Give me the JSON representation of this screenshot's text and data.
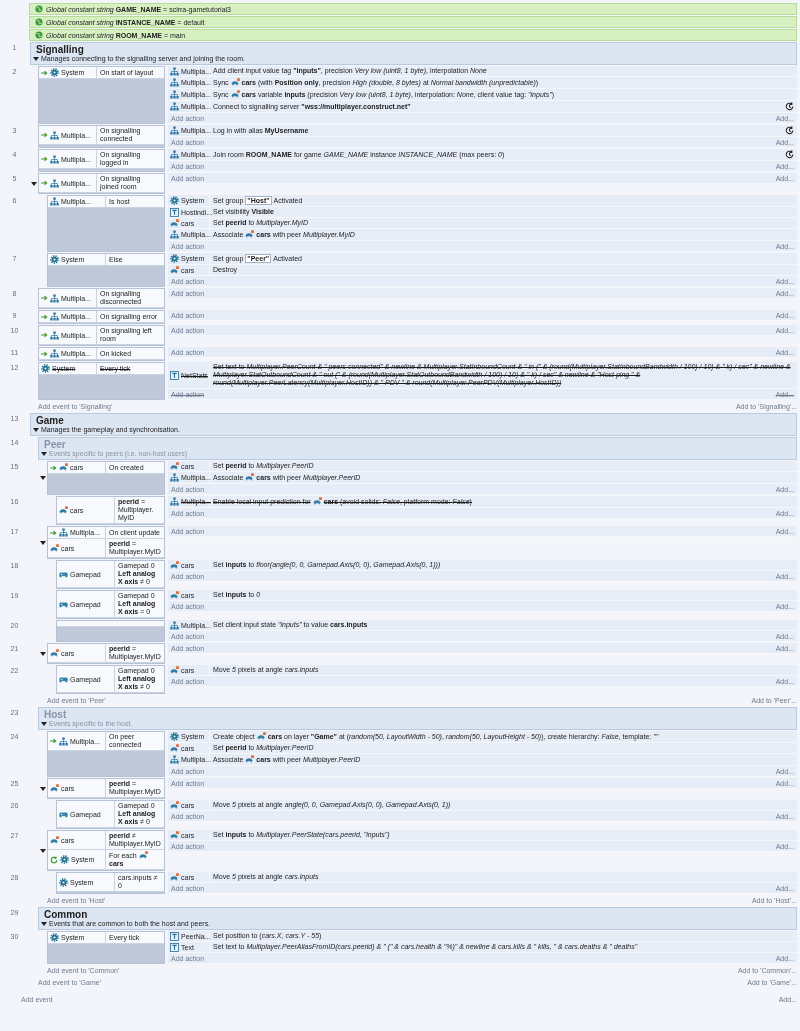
{
  "globals": [
    {
      "text": "*Global constant string* **GAME_NAME** = scirra-gametutorial3"
    },
    {
      "text": "*Global constant string* **INSTANCE_NAME** = default"
    },
    {
      "text": "*Global constant string* **ROOM_NAME** = main"
    }
  ],
  "sheet": [
    {
      "kind": "group",
      "number": "1",
      "title": "Signalling",
      "description": "Manages connecting to the signalling server and joining the room.",
      "active": true,
      "expanded": true,
      "add_event": "Add event to 'Signalling'",
      "add_to": "Add to 'Signalling'...",
      "children": [
        {
          "kind": "event",
          "number": "2",
          "disabled": false,
          "conditions": [
            {
              "object": {
                "name": "System",
                "kind": "system"
              },
              "kind": "trigger",
              "text": "On start of layout"
            }
          ],
          "actions": [
            {
              "object": {
                "name": "Multipla...",
                "kind": "multiplayer"
              },
              "disabled": false,
              "async": false,
              "text": "Add client input value tag **\"inputs\"**, precision *Very low (uint8, 1 byte)*, interpolation *None*"
            },
            {
              "object": {
                "name": "Multipla...",
                "kind": "multiplayer"
              },
              "disabled": false,
              "async": false,
              "parts": [
                {
                  "kind": "text",
                  "text": "Sync"
                },
                {
                  "kind": "sprite"
                },
                {
                  "kind": "text",
                  "text": "**cars** (with **Position only**, precision *High (double, 8 bytes)* at *Normal bandwidth (unpredictable)*)"
                }
              ]
            },
            {
              "object": {
                "name": "Multipla...",
                "kind": "multiplayer"
              },
              "disabled": false,
              "async": false,
              "parts": [
                {
                  "kind": "text",
                  "text": "Sync"
                },
                {
                  "kind": "sprite"
                },
                {
                  "kind": "text",
                  "text": "**cars** variable **inputs** (precision *Very low (uint8, 1 byte)*, interpolation: *None*, client value tag: *\"inputs\"*)"
                }
              ]
            },
            {
              "object": {
                "name": "Multipla...",
                "kind": "multiplayer"
              },
              "disabled": false,
              "async": true,
              "text": "Connect to signalling server **\"wss://multiplayer.construct.net\"**"
            }
          ],
          "add_action": "Add action",
          "add_more": "Add..."
        },
        {
          "kind": "event",
          "number": "3",
          "disabled": false,
          "conditions": [
            {
              "object": {
                "name": "Multipla...",
                "kind": "multiplayer"
              },
              "kind": "trigger",
              "text": "On signalling connected"
            }
          ],
          "actions": [
            {
              "object": {
                "name": "Multipla...",
                "kind": "multiplayer"
              },
              "disabled": false,
              "async": true,
              "text": "Log in with alias **MyUsername**"
            }
          ],
          "add_action": "Add action",
          "add_more": "Add..."
        },
        {
          "kind": "event",
          "number": "4",
          "disabled": false,
          "conditions": [
            {
              "object": {
                "name": "Multipla...",
                "kind": "multiplayer"
              },
              "kind": "trigger",
              "text": "On signalling logged in"
            }
          ],
          "actions": [
            {
              "object": {
                "name": "Multipla...",
                "kind": "multiplayer"
              },
              "disabled": false,
              "async": true,
              "text": "Join room **ROOM_NAME** for game *GAME_NAME* instance *INSTANCE_NAME* (max peers: *0*)"
            }
          ],
          "add_action": "Add action",
          "add_more": "Add..."
        },
        {
          "kind": "event",
          "number": "5",
          "disabled": false,
          "expanded": true,
          "conditions": [
            {
              "object": {
                "name": "Multipla...",
                "kind": "multiplayer"
              },
              "kind": "trigger",
              "text": "On signalling joined room"
            }
          ],
          "add_action": "Add action",
          "add_more": "Add...",
          "children": [
            {
              "kind": "event",
              "number": "6",
              "disabled": false,
              "conditions": [
                {
                  "object": {
                    "name": "Multipla...",
                    "kind": "multiplayer"
                  },
                  "text": "Is host"
                }
              ],
              "actions": [
                {
                  "object": {
                    "name": "System",
                    "kind": "system"
                  },
                  "disabled": false,
                  "async": false,
                  "parts": [
                    {
                      "kind": "text",
                      "text": "Set group"
                    },
                    {
                      "kind": "chip",
                      "text": "\"Host\""
                    },
                    {
                      "kind": "text",
                      "text": "Activated"
                    }
                  ]
                },
                {
                  "object": {
                    "name": "Hostindi...",
                    "kind": "text"
                  },
                  "disabled": false,
                  "async": false,
                  "text": "Set visibility **Visible**"
                },
                {
                  "object": {
                    "name": "cars",
                    "kind": "sprite"
                  },
                  "disabled": false,
                  "async": false,
                  "text": "Set **peerid** to *Multiplayer.MyID*"
                },
                {
                  "object": {
                    "name": "Multipla...",
                    "kind": "multiplayer"
                  },
                  "disabled": false,
                  "async": false,
                  "parts": [
                    {
                      "kind": "text",
                      "text": "Associate"
                    },
                    {
                      "kind": "sprite"
                    },
                    {
                      "kind": "text",
                      "text": "**cars** with peer *Multiplayer.MyID*"
                    }
                  ]
                }
              ],
              "add_action": "Add action",
              "add_more": "Add..."
            },
            {
              "kind": "event",
              "number": "7",
              "disabled": false,
              "conditions": [
                {
                  "object": {
                    "name": "System",
                    "kind": "system"
                  },
                  "text": "Else"
                }
              ],
              "actions": [
                {
                  "object": {
                    "name": "System",
                    "kind": "system"
                  },
                  "disabled": false,
                  "async": false,
                  "parts": [
                    {
                      "kind": "text",
                      "text": "Set group"
                    },
                    {
                      "kind": "chip",
                      "text": "\"Peer\""
                    },
                    {
                      "kind": "text",
                      "text": "Activated"
                    }
                  ]
                },
                {
                  "object": {
                    "name": "cars",
                    "kind": "sprite"
                  },
                  "disabled": false,
                  "async": false,
                  "text": "Destroy"
                }
              ],
              "add_action": "Add action",
              "add_more": "Add..."
            }
          ]
        },
        {
          "kind": "event",
          "number": "8",
          "disabled": false,
          "conditions": [
            {
              "object": {
                "name": "Multipla...",
                "kind": "multiplayer"
              },
              "kind": "trigger",
              "text": "On signalling disconnected"
            }
          ],
          "add_action": "Add action",
          "add_more": "Add..."
        },
        {
          "kind": "event",
          "number": "9",
          "disabled": false,
          "conditions": [
            {
              "object": {
                "name": "Multipla...",
                "kind": "multiplayer"
              },
              "kind": "trigger",
              "text": "On signalling error"
            }
          ],
          "add_action": "Add action",
          "add_more": "Add..."
        },
        {
          "kind": "event",
          "number": "10",
          "disabled": false,
          "conditions": [
            {
              "object": {
                "name": "Multipla...",
                "kind": "multiplayer"
              },
              "kind": "trigger",
              "text": "On signalling left room"
            }
          ],
          "add_action": "Add action",
          "add_more": "Add..."
        },
        {
          "kind": "event",
          "number": "11",
          "disabled": false,
          "conditions": [
            {
              "object": {
                "name": "Multipla...",
                "kind": "multiplayer"
              },
              "kind": "trigger",
              "text": "On kicked"
            }
          ],
          "add_action": "Add action",
          "add_more": "Add..."
        },
        {
          "kind": "event",
          "number": "12",
          "disabled": true,
          "conditions": [
            {
              "object": {
                "name": "System",
                "kind": "system"
              },
              "text": "Every tick"
            }
          ],
          "actions": [
            {
              "object": {
                "name": "NetStats",
                "kind": "text"
              },
              "disabled": false,
              "async": false,
              "text": "Set text to *Multiplayer.PeerCount & \" peers connected\" & newline & Multiplayer.StatInboundCount & \" in (\" & (round(Multiplayer.StatInboundBandwidth / 100) / 10) & \" k) / sec\" & newline & Multiplayer.StatOutboundCount & \" out (\" & (round(Multiplayer.StatOutboundBandwidth / 100) / 10) & \" k) / sec\" & newline & \"Host ping \" & round(Multiplayer.PeerLatency(Multiplayer.HostID)) & \" PDV \" & round(Multiplayer.PeerPDV(Multiplayer.HostID))*"
            }
          ],
          "add_action": "Add action",
          "add_more": "Add..."
        }
      ]
    },
    {
      "kind": "group",
      "number": "13",
      "title": "Game",
      "description": "Manages the gameplay and synchronisation.",
      "active": true,
      "expanded": true,
      "add_event": "Add event to 'Game'",
      "add_to": "Add to 'Game'...",
      "children": [
        {
          "kind": "group",
          "number": "14",
          "title": "Peer",
          "description": "Events specific to peers (i.e. non-host users)",
          "active": false,
          "expanded": true,
          "add_event": "Add event to 'Peer'",
          "add_to": "Add to 'Peer'...",
          "children": [
            {
              "kind": "event",
              "number": "15",
              "disabled": false,
              "expanded": true,
              "conditions": [
                {
                  "object": {
                    "name": "cars",
                    "kind": "sprite"
                  },
                  "kind": "trigger",
                  "text": "On created"
                }
              ],
              "actions": [
                {
                  "object": {
                    "name": "cars",
                    "kind": "sprite"
                  },
                  "disabled": false,
                  "async": false,
                  "text": "Set **peerid** to *Multiplayer.PeerID*"
                },
                {
                  "object": {
                    "name": "Multipla...",
                    "kind": "multiplayer"
                  },
                  "disabled": false,
                  "async": false,
                  "parts": [
                    {
                      "kind": "text",
                      "text": "Associate"
                    },
                    {
                      "kind": "sprite"
                    },
                    {
                      "kind": "text",
                      "text": "**cars** with peer *Multiplayer.PeerID*"
                    }
                  ]
                }
              ],
              "add_action": "Add action",
              "add_more": "Add...",
              "children": [
                {
                  "kind": "event",
                  "number": "16",
                  "disabled": false,
                  "conditions": [
                    {
                      "object": {
                        "name": "cars",
                        "kind": "sprite"
                      },
                      "text": "**peerid** = Multiplayer. MyID"
                    }
                  ],
                  "actions": [
                    {
                      "object": {
                        "name": "Multipla...",
                        "kind": "multiplayer"
                      },
                      "disabled": true,
                      "async": false,
                      "parts": [
                        {
                          "kind": "text",
                          "text": "Enable local input prediction for"
                        },
                        {
                          "kind": "sprite"
                        },
                        {
                          "kind": "text",
                          "text": "**cars** (avoid solids: *False*, platform mode: *False*)"
                        }
                      ]
                    }
                  ],
                  "add_action": "Add action",
                  "add_more": "Add..."
                }
              ]
            },
            {
              "kind": "event",
              "number": "17",
              "disabled": false,
              "expanded": true,
              "conditions": [
                {
                  "object": {
                    "name": "Multipla...",
                    "kind": "multiplayer"
                  },
                  "kind": "trigger",
                  "text": "On client update"
                },
                {
                  "object": {
                    "name": "cars",
                    "kind": "sprite"
                  },
                  "text": "**peerid** = Multiplayer.MyID"
                }
              ],
              "add_action": "Add action",
              "add_more": "Add...",
              "children": [
                {
                  "kind": "event",
                  "number": "18",
                  "disabled": false,
                  "conditions": [
                    {
                      "object": {
                        "name": "Gamepad",
                        "kind": "gamepad"
                      },
                      "text": "Gamepad 0 **Left analog X axis** ≠ 0"
                    }
                  ],
                  "actions": [
                    {
                      "object": {
                        "name": "cars",
                        "kind": "sprite"
                      },
                      "disabled": false,
                      "async": false,
                      "text": "Set **inputs** to *floor(angle(0, 0, Gamepad.Axis(0, 0), Gamepad.Axis(0, 1)))*"
                    }
                  ],
                  "add_action": "Add action",
                  "add_more": "Add..."
                },
                {
                  "kind": "event",
                  "number": "19",
                  "disabled": false,
                  "conditions": [
                    {
                      "object": {
                        "name": "Gamepad",
                        "kind": "gamepad"
                      },
                      "text": "Gamepad 0 **Left analog X axis** = 0"
                    }
                  ],
                  "actions": [
                    {
                      "object": {
                        "name": "cars",
                        "kind": "sprite"
                      },
                      "disabled": false,
                      "async": false,
                      "text": "Set **inputs** to *0*"
                    }
                  ],
                  "add_action": "Add action",
                  "add_more": "Add..."
                },
                {
                  "kind": "event",
                  "number": "20",
                  "disabled": false,
                  "actions": [
                    {
                      "object": {
                        "name": "Multipla...",
                        "kind": "multiplayer"
                      },
                      "disabled": false,
                      "async": false,
                      "text": "Set client input state *\"inputs\"* to value **cars.inputs**"
                    }
                  ],
                  "add_action": "Add action",
                  "add_more": "Add..."
                }
              ]
            },
            {
              "kind": "event",
              "number": "21",
              "disabled": false,
              "expanded": true,
              "conditions": [
                {
                  "object": {
                    "name": "cars",
                    "kind": "sprite"
                  },
                  "text": "**peerid** = Multiplayer.MyID"
                }
              ],
              "add_action": "Add action",
              "add_more": "Add...",
              "children": [
                {
                  "kind": "event",
                  "number": "22",
                  "disabled": false,
                  "conditions": [
                    {
                      "object": {
                        "name": "Gamepad",
                        "kind": "gamepad"
                      },
                      "text": "Gamepad 0 **Left analog X axis** ≠ 0"
                    }
                  ],
                  "actions": [
                    {
                      "object": {
                        "name": "cars",
                        "kind": "sprite"
                      },
                      "disabled": false,
                      "async": false,
                      "text": "Move *5* pixels at angle *cars.inputs*"
                    }
                  ],
                  "add_action": "Add action",
                  "add_more": "Add..."
                }
              ]
            }
          ]
        },
        {
          "kind": "group",
          "number": "23",
          "title": "Host",
          "description": "Events specific to the host.",
          "active": false,
          "expanded": true,
          "add_event": "Add event to 'Host'",
          "add_to": "Add to 'Host'...",
          "children": [
            {
              "kind": "event",
              "number": "24",
              "disabled": false,
              "conditions": [
                {
                  "object": {
                    "name": "Multipla...",
                    "kind": "multiplayer"
                  },
                  "kind": "trigger",
                  "text": "On peer connected"
                }
              ],
              "actions": [
                {
                  "object": {
                    "name": "System",
                    "kind": "system"
                  },
                  "disabled": false,
                  "async": false,
                  "parts": [
                    {
                      "kind": "text",
                      "text": "Create object"
                    },
                    {
                      "kind": "sprite"
                    },
                    {
                      "kind": "text",
                      "text": "**cars** on layer **\"Game\"** at (*random(50, LayoutWidth - 50)*, *random(50, LayoutHeight - 50)*), create hierarchy: *False*, template: *\"\"*"
                    }
                  ]
                },
                {
                  "object": {
                    "name": "cars",
                    "kind": "sprite"
                  },
                  "disabled": false,
                  "async": false,
                  "text": "Set **peerid** to *Multiplayer.PeerID*"
                },
                {
                  "object": {
                    "name": "Multipla...",
                    "kind": "multiplayer"
                  },
                  "disabled": false,
                  "async": false,
                  "parts": [
                    {
                      "kind": "text",
                      "text": "Associate"
                    },
                    {
                      "kind": "sprite"
                    },
                    {
                      "kind": "text",
                      "text": "**cars** with peer *Multiplayer.PeerID*"
                    }
                  ]
                }
              ],
              "add_action": "Add action",
              "add_more": "Add..."
            },
            {
              "kind": "event",
              "number": "25",
              "disabled": false,
              "expanded": true,
              "conditions": [
                {
                  "object": {
                    "name": "cars",
                    "kind": "sprite"
                  },
                  "text": "**peerid** = Multiplayer.MyID"
                }
              ],
              "add_action": "Add action",
              "add_more": "Add...",
              "children": [
                {
                  "kind": "event",
                  "number": "26",
                  "disabled": false,
                  "conditions": [
                    {
                      "object": {
                        "name": "Gamepad",
                        "kind": "gamepad"
                      },
                      "text": "Gamepad 0 **Left analog X axis** ≠ 0"
                    }
                  ],
                  "actions": [
                    {
                      "object": {
                        "name": "cars",
                        "kind": "sprite"
                      },
                      "disabled": false,
                      "async": false,
                      "text": "Move *5* pixels at angle *angle(0, 0, Gamepad.Axis(0, 0), Gamepad.Axis(0, 1))*"
                    }
                  ],
                  "add_action": "Add action",
                  "add_more": "Add..."
                }
              ]
            },
            {
              "kind": "event",
              "number": "27",
              "disabled": false,
              "expanded": true,
              "conditions": [
                {
                  "object": {
                    "name": "cars",
                    "kind": "sprite"
                  },
                  "text": "**peerid** ≠ Multiplayer.MyID"
                },
                {
                  "object": {
                    "name": "System",
                    "kind": "system"
                  },
                  "kind": "loop",
                  "parts": [
                    {
                      "kind": "text",
                      "text": "For each"
                    },
                    {
                      "kind": "sprite"
                    },
                    {
                      "kind": "text",
                      "text": "**cars**"
                    }
                  ]
                }
              ],
              "actions": [
                {
                  "object": {
                    "name": "cars",
                    "kind": "sprite"
                  },
                  "disabled": false,
                  "async": false,
                  "text": "Set **inputs** to *Multiplayer.PeerState(cars.peerid, \"inputs\")*"
                }
              ],
              "add_action": "Add action",
              "add_more": "Add...",
              "children": [
                {
                  "kind": "event",
                  "number": "28",
                  "disabled": false,
                  "conditions": [
                    {
                      "object": {
                        "name": "System",
                        "kind": "system"
                      },
                      "text": "cars.inputs ≠ 0"
                    }
                  ],
                  "actions": [
                    {
                      "object": {
                        "name": "cars",
                        "kind": "sprite"
                      },
                      "disabled": false,
                      "async": false,
                      "text": "Move *5* pixels at angle *cars.inputs*"
                    }
                  ],
                  "add_action": "Add action",
                  "add_more": "Add..."
                }
              ]
            }
          ]
        },
        {
          "kind": "group",
          "number": "29",
          "title": "Common",
          "description": "Events that are common to both the host and peers.",
          "active": true,
          "expanded": true,
          "add_event": "Add event to 'Common'",
          "add_to": "Add to 'Common'...",
          "children": [
            {
              "kind": "event",
              "number": "30",
              "disabled": false,
              "conditions": [
                {
                  "object": {
                    "name": "System",
                    "kind": "system"
                  },
                  "text": "Every tick"
                }
              ],
              "actions": [
                {
                  "object": {
                    "name": "PeerNa...",
                    "kind": "text"
                  },
                  "disabled": false,
                  "async": false,
                  "text": "Set position to (*cars.X*, *cars.Y - 55*)"
                },
                {
                  "object": {
                    "name": "Text",
                    "kind": "text"
                  },
                  "disabled": false,
                  "async": false,
                  "text": "Set text to *Multiplayer.PeerAliasFromID(cars.peerid) & \" (\" & cars.health & \"%)\" & newline & cars.kills & \" kills, \" & cars.deaths & \" deaths\"*"
                }
              ],
              "add_action": "Add action",
              "add_more": "Add..."
            }
          ]
        }
      ]
    }
  ],
  "footer": {
    "add_event": "Add event",
    "add_more": "Add..."
  }
}
